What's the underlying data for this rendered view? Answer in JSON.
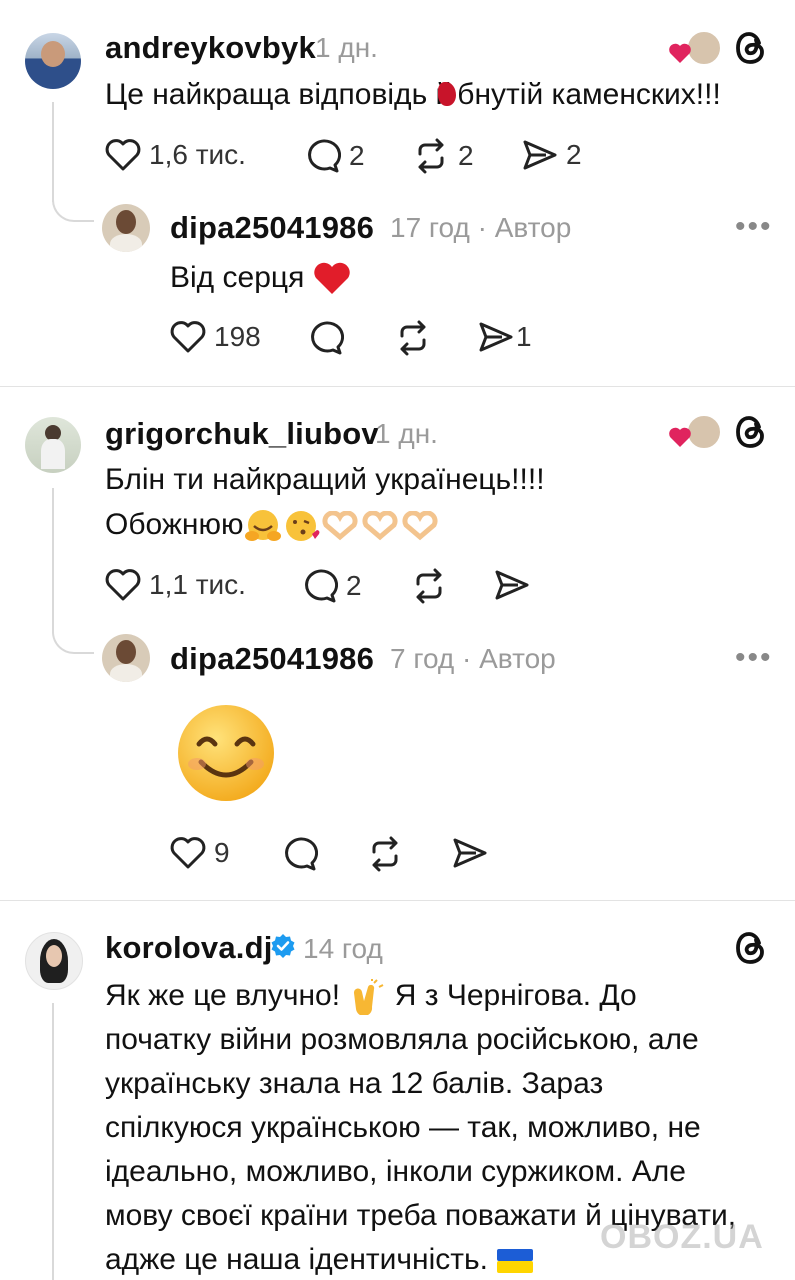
{
  "comments": [
    {
      "username": "andreykovbyk",
      "time": "1 дн.",
      "text": "Це найкраща відповідь й",
      "text_tail": "бнутій каменских!!!",
      "likes": "1,6 тис.",
      "replies": "2",
      "reposts": "2",
      "shares": "2",
      "reply": {
        "username": "dipa25041986",
        "time": "17 год",
        "author_label": "· Автор",
        "text": "Від серця",
        "likes": "198",
        "shares": "1"
      }
    },
    {
      "username": "grigorchuk_liubov",
      "time": "1 дн.",
      "text_line1": "Блін ти найкращий українець!!!!",
      "text_line2": "Обожнюю",
      "likes": "1,1 тис.",
      "replies": "2",
      "reply": {
        "username": "dipa25041986",
        "time": "7 год",
        "author_label": "· Автор",
        "likes": "9"
      }
    },
    {
      "username": "korolova.dj",
      "time": "14 год",
      "verified": true,
      "lines": [
        "Як же це влучно!",
        "Я з Чернігова. До",
        "початку війни розмовляла російською, але",
        "українську знала на 12 балів. Зараз",
        "спілкуюся українською — так, можливо, не",
        "ідеально, можливо, інколи суржиком. Але",
        "мову своєї країни треба поважати й цінувати,",
        "адже це наша ідентичність."
      ]
    }
  ],
  "watermark": "OBOZ.UA",
  "colors": {
    "verified": "#1d9bf0",
    "heart": "#e0245e",
    "divider": "#e3e3e3",
    "muted": "#9a9a9a"
  },
  "icons": [
    "heart-icon",
    "comment-icon",
    "repost-icon",
    "share-icon",
    "threads-logo-icon",
    "more-icon",
    "verified-badge-icon"
  ]
}
